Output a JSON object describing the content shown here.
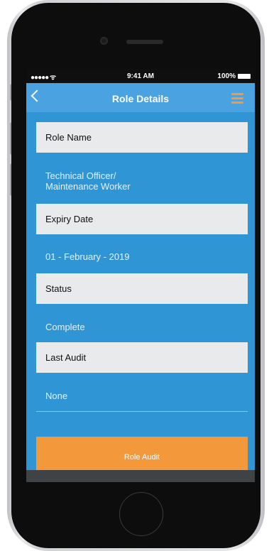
{
  "status_bar": {
    "signal": "●●●●● ᯤ",
    "time": "9:41 AM",
    "battery": "100%"
  },
  "nav": {
    "title": "Role Details",
    "colors": {
      "nav": "#4aa3e0",
      "menu": "#f59a3c"
    }
  },
  "fields": [
    {
      "label": "Role Name",
      "value_line1": "Technical Officer/",
      "value_line2": "Maintenance Worker"
    },
    {
      "label": "Expiry Date",
      "value": "01 - February - 2019"
    },
    {
      "label": "Status",
      "value": "Complete"
    },
    {
      "label": "Last Audit",
      "value": "None"
    }
  ],
  "actions": {
    "role_audit_label": "Role Audit"
  },
  "colors": {
    "screen_bg": "#2f95d5",
    "field_bg": "#e9eaec",
    "button": "#f4983c"
  }
}
